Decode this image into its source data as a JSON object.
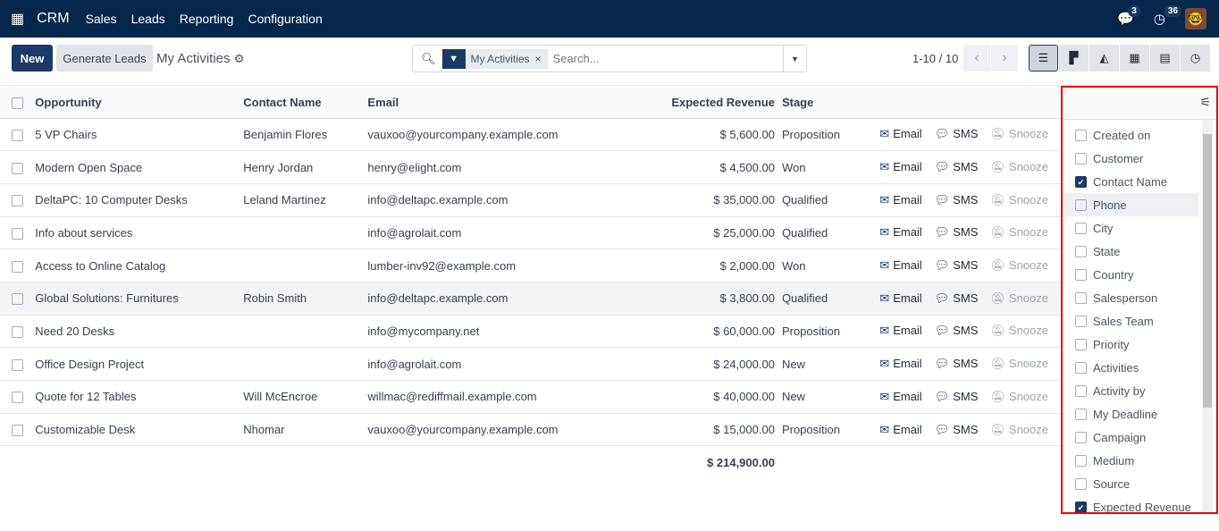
{
  "nav": {
    "app": "CRM",
    "menu": [
      "Sales",
      "Leads",
      "Reporting",
      "Configuration"
    ],
    "messages_count": "3",
    "activities_count": "36"
  },
  "control": {
    "new": "New",
    "generate": "Generate Leads",
    "title": "My Activities",
    "facet": "My Activities",
    "search_placeholder": "Search...",
    "pager": "1-10 / 10"
  },
  "table": {
    "headers": [
      "Opportunity",
      "Contact Name",
      "Email",
      "Expected Revenue",
      "Stage"
    ],
    "actions": [
      "Email",
      "SMS",
      "Snooze"
    ],
    "rows": [
      [
        "5 VP Chairs",
        "Benjamin Flores",
        "vauxoo@yourcompany.example.com",
        "$ 5,600.00",
        "Proposition"
      ],
      [
        "Modern Open Space",
        "Henry Jordan",
        "henry@elight.com",
        "$ 4,500.00",
        "Won"
      ],
      [
        "DeltaPC: 10 Computer Desks",
        "Leland Martinez",
        "info@deltapc.example.com",
        "$ 35,000.00",
        "Qualified"
      ],
      [
        "Info about services",
        "",
        "info@agrolait.com",
        "$ 25,000.00",
        "Qualified"
      ],
      [
        "Access to Online Catalog",
        "",
        "lumber-inv92@example.com",
        "$ 2,000.00",
        "Won"
      ],
      [
        "Global Solutions: Furnitures",
        "Robin Smith",
        "info@deltapc.example.com",
        "$ 3,800.00",
        "Qualified"
      ],
      [
        "Need 20 Desks",
        "",
        "info@mycompany.net",
        "$ 60,000.00",
        "Proposition"
      ],
      [
        "Office Design Project",
        "",
        "info@agrolait.com",
        "$ 24,000.00",
        "New"
      ],
      [
        "Quote for 12 Tables",
        "Will McEncroe",
        "willmac@rediffmail.example.com",
        "$ 40,000.00",
        "New"
      ],
      [
        "Customizable Desk",
        "Nhomar",
        "vauxoo@yourcompany.example.com",
        "$ 15,000.00",
        "Proposition"
      ]
    ],
    "total": "$ 214,900.00"
  },
  "columns_panel": [
    {
      "label": "Created on",
      "checked": false
    },
    {
      "label": "Customer",
      "checked": false
    },
    {
      "label": "Contact Name",
      "checked": true
    },
    {
      "label": "Phone",
      "checked": false
    },
    {
      "label": "City",
      "checked": false
    },
    {
      "label": "State",
      "checked": false
    },
    {
      "label": "Country",
      "checked": false
    },
    {
      "label": "Salesperson",
      "checked": false
    },
    {
      "label": "Sales Team",
      "checked": false
    },
    {
      "label": "Priority",
      "checked": false
    },
    {
      "label": "Activities",
      "checked": false
    },
    {
      "label": "Activity by",
      "checked": false
    },
    {
      "label": "My Deadline",
      "checked": false
    },
    {
      "label": "Campaign",
      "checked": false
    },
    {
      "label": "Medium",
      "checked": false
    },
    {
      "label": "Source",
      "checked": false
    },
    {
      "label": "Expected Revenue",
      "checked": true
    }
  ],
  "colors": {
    "navbar": "#06264a",
    "primary": "#183a64",
    "highlight": "#e00000"
  }
}
